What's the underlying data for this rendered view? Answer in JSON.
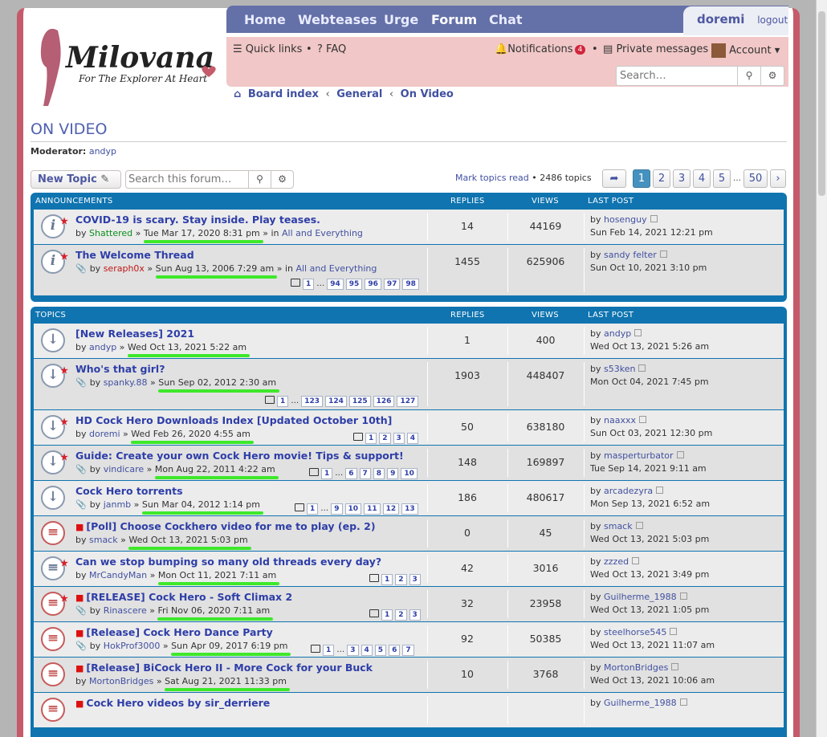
{
  "header": {
    "nav": [
      "Home",
      "Webteases",
      "Urge",
      "Forum",
      "Chat"
    ],
    "user": "doremi",
    "logout": "logout",
    "quick_links": "Quick links",
    "faq": "FAQ",
    "notifications": "Notifications",
    "notif_count": "4",
    "private_messages": "Private messages",
    "account": "Account",
    "search_placeholder": "Search…"
  },
  "logo": {
    "brand": "Milovana",
    "tagline": "For The Explorer At Heart"
  },
  "crumbs": [
    "Board index",
    "General",
    "On Video"
  ],
  "forum": {
    "title": "ON VIDEO",
    "moderator_label": "Moderator:",
    "moderator": "andyp",
    "new_topic": "New Topic",
    "search_placeholder": "Search this forum…",
    "mark_read": "Mark topics read",
    "topic_count": "• 2486 topics",
    "pages": [
      "1",
      "2",
      "3",
      "4",
      "5",
      "…",
      "50"
    ],
    "current_page": "1"
  },
  "columns": {
    "announcements": "ANNOUNCEMENTS",
    "topics": "TOPICS",
    "replies": "REPLIES",
    "views": "VIEWS",
    "last_post": "LAST POST"
  },
  "announcements": [
    {
      "title": "COVID-19 is scary. Stay inside. Play teases.",
      "author": "Shattered",
      "date": "Tue Mar 17, 2020 8:31 pm",
      "forum": "All and Everything",
      "replies": "14",
      "views": "44169",
      "last_user": "hosenguy",
      "last_date": "Sun Feb 14, 2021 12:21 pm"
    },
    {
      "title": "The Welcome Thread",
      "author": "seraph0x",
      "date": "Sun Aug 13, 2006 7:29 am",
      "forum": "All and Everything",
      "replies": "1455",
      "views": "625906",
      "last_user": "sandy felter",
      "last_date": "Sun Oct 10, 2021 3:10 pm",
      "pages": [
        "1",
        "…",
        "94",
        "95",
        "96",
        "97",
        "98"
      ]
    }
  ],
  "topics": [
    {
      "title": "[New Releases] 2021",
      "author": "andyp",
      "date": "Wed Oct 13, 2021 5:22 am",
      "replies": "1",
      "views": "400",
      "last_user": "andyp",
      "last_date": "Wed Oct 13, 2021 5:26 am"
    },
    {
      "title": "Who's that girl?",
      "author": "spanky.88",
      "date": "Sun Sep 02, 2012 2:30 am",
      "replies": "1903",
      "views": "448407",
      "last_user": "s53ken",
      "last_date": "Mon Oct 04, 2021 7:45 pm",
      "pages": [
        "1",
        "…",
        "123",
        "124",
        "125",
        "126",
        "127"
      ]
    },
    {
      "title": "HD Cock Hero Downloads Index [Updated October 10th]",
      "author": "doremi",
      "date": "Wed Feb 26, 2020 4:55 am",
      "replies": "50",
      "views": "638180",
      "last_user": "naaxxx",
      "last_date": "Sun Oct 03, 2021 12:30 pm",
      "pages": [
        "1",
        "2",
        "3",
        "4"
      ]
    },
    {
      "title": "Guide: Create your own Cock Hero movie! Tips & support!",
      "author": "vindicare",
      "date": "Mon Aug 22, 2011 4:22 am",
      "replies": "148",
      "views": "169897",
      "last_user": "masperturbator",
      "last_date": "Tue Sep 14, 2021 9:11 am",
      "pages": [
        "1",
        "…",
        "6",
        "7",
        "8",
        "9",
        "10"
      ]
    },
    {
      "title": "Cock Hero torrents",
      "author": "janmb",
      "date": "Sun Mar 04, 2012 1:14 pm",
      "replies": "186",
      "views": "480617",
      "last_user": "arcadezyra",
      "last_date": "Mon Sep 13, 2021 6:52 am",
      "pages": [
        "1",
        "…",
        "9",
        "10",
        "11",
        "12",
        "13"
      ]
    },
    {
      "title": "[Poll] Choose Cockhero video for me to play (ep. 2)",
      "author": "smack",
      "date": "Wed Oct 13, 2021 5:03 pm",
      "replies": "0",
      "views": "45",
      "last_user": "smack",
      "last_date": "Wed Oct 13, 2021 5:03 pm"
    },
    {
      "title": "Can we stop bumping so many old threads every day?",
      "author": "MrCandyMan",
      "date": "Mon Oct 11, 2021 7:11 am",
      "replies": "42",
      "views": "3016",
      "last_user": "zzzed",
      "last_date": "Wed Oct 13, 2021 3:49 pm",
      "pages": [
        "1",
        "2",
        "3"
      ]
    },
    {
      "title": "[RELEASE] Cock Hero - Soft Climax 2",
      "author": "Rinascere",
      "date": "Fri Nov 06, 2020 7:11 am",
      "replies": "32",
      "views": "23958",
      "last_user": "Guilherme_1988",
      "last_date": "Wed Oct 13, 2021 1:05 pm",
      "pages": [
        "1",
        "2",
        "3"
      ]
    },
    {
      "title": "[Release] Cock Hero Dance Party",
      "author": "HokProf3000",
      "date": "Sun Apr 09, 2017 6:19 pm",
      "replies": "92",
      "views": "50385",
      "last_user": "steelhorse545",
      "last_date": "Wed Oct 13, 2021 11:07 am",
      "pages": [
        "1",
        "…",
        "3",
        "4",
        "5",
        "6",
        "7"
      ]
    },
    {
      "title": "[Release] BiCock Hero II - More Cock for your Buck",
      "author": "MortonBridges",
      "date": "Sat Aug 21, 2021 11:33 pm",
      "replies": "10",
      "views": "3768",
      "last_user": "MortonBridges",
      "last_date": "Wed Oct 13, 2021 10:06 am"
    },
    {
      "title": "Cock Hero videos by sir_derriere",
      "last_user": "Guilherme_1988"
    }
  ]
}
